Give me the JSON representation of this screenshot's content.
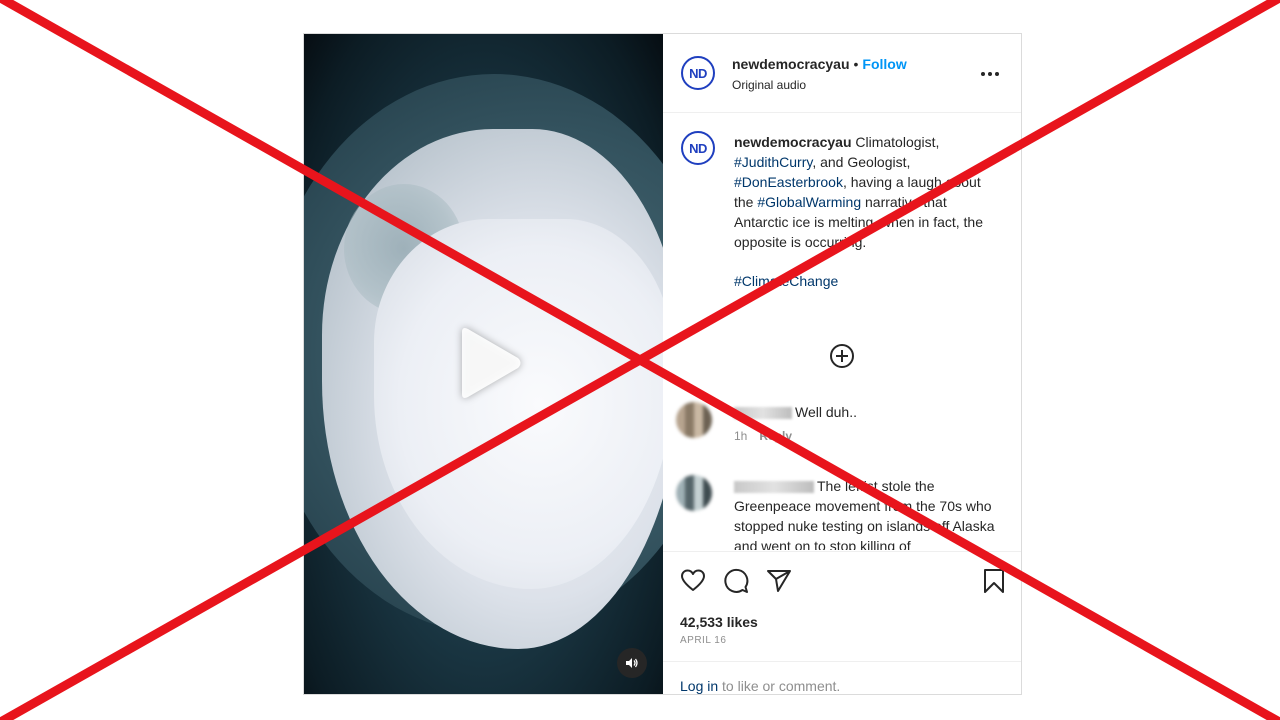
{
  "post": {
    "username": "newdemocracyau",
    "avatar_initials": "ND",
    "follow_label": "Follow",
    "separator": "•",
    "audio_label": "Original audio",
    "caption": {
      "username": "newdemocracyau",
      "seg1": " Climatologist, ",
      "tag1": "#JudithCurry",
      "seg2": ", and Geologist, ",
      "tag2": "#DonEasterbrook",
      "seg3": ", having a laugh about the ",
      "tag3": "#GlobalWarming",
      "seg4": " narrative that Antarctic ice is melting, when in fact, the opposite is occurring.",
      "tag4": "#ClimateChange"
    },
    "comments": [
      {
        "text": "Well duh..",
        "time": "1h",
        "reply_label": "Reply"
      },
      {
        "text": "The leftist stole the Greenpeace movement from the 70s who stopped nuke testing on islands off Alaska and went on to stop killing of"
      }
    ],
    "likes": "42,533 likes",
    "date": "APRIL 16",
    "login_link": "Log in",
    "login_rest": " to like or comment."
  },
  "icons": {
    "play": "play-icon",
    "audio": "speaker-icon",
    "more": "more-dots-icon",
    "load_more": "plus-circle-icon",
    "like": "heart-icon",
    "comment": "comment-bubble-icon",
    "share": "paper-plane-icon",
    "save": "bookmark-icon"
  },
  "colors": {
    "follow": "#0095f6",
    "hashtag": "#00376b",
    "cross": "#e8141c",
    "avatar_ring": "#1f3fbf"
  }
}
